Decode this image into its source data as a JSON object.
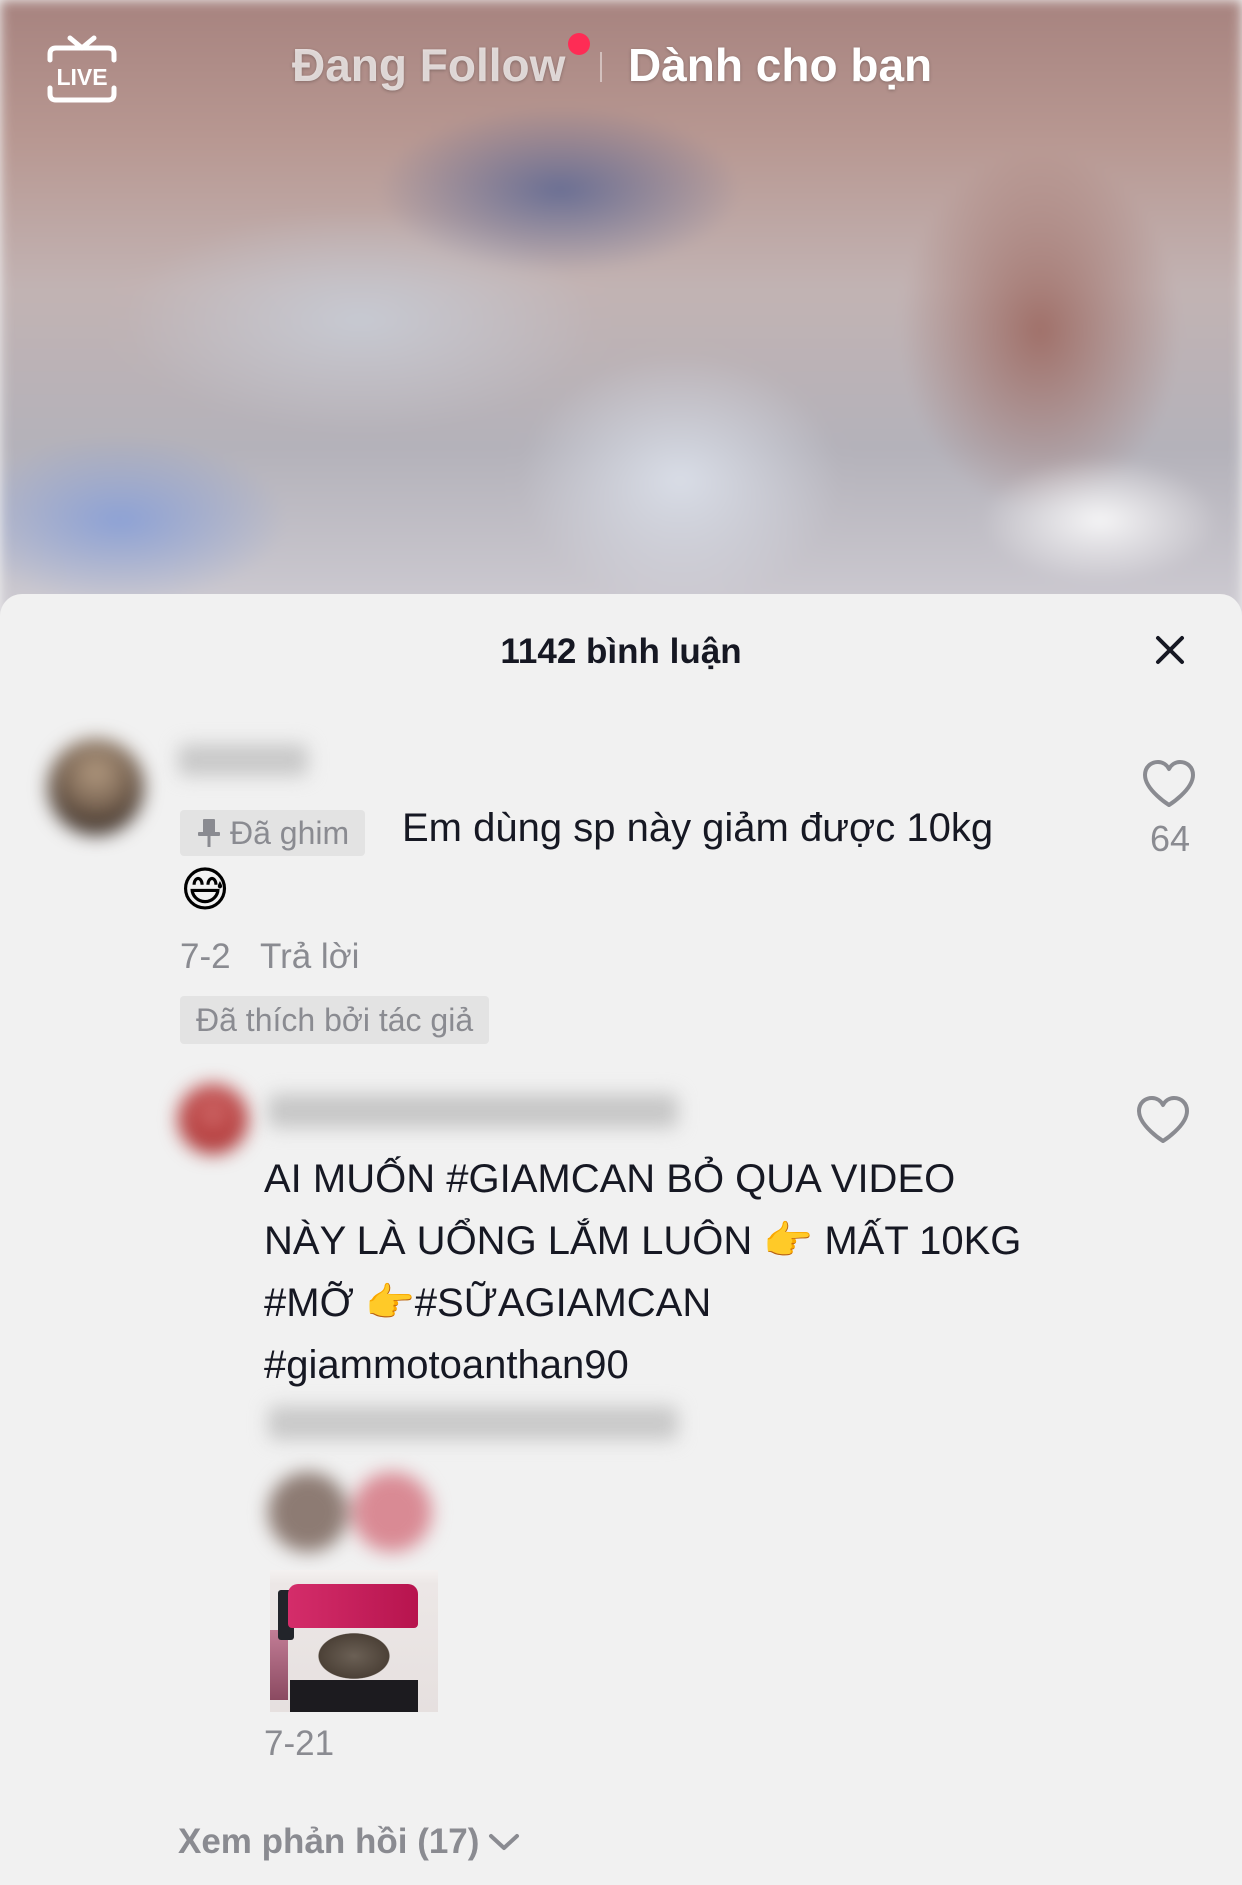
{
  "top_nav": {
    "live_label": "LIVE",
    "following_tab": "Đang Follow",
    "for_you_tab": "Dành cho bạn"
  },
  "comments_sheet": {
    "title": "1142 bình luận",
    "comments": [
      {
        "pinned_label": "Đã ghim",
        "text": "Em dùng sp này giảm được 10kg",
        "emoji": "😅",
        "date": "7-2",
        "reply_label": "Trả lời",
        "liked_by_author_label": "Đã thích bởi tác giả",
        "like_count": "64"
      },
      {
        "text_lines": [
          "AI MUỐN #GIAMCAN BỎ QUA VIDEO",
          "NÀY LÀ UỔNG LẮM LUÔN 👉 MẤT 10KG",
          "#MỠ  👉#SỮAGIAMCAN",
          "#giammotoanthan90"
        ],
        "date": "7-21",
        "view_replies_label": "Xem phản hồi (17)"
      }
    ]
  },
  "colors": {
    "accent": "#fe2c55",
    "text_primary": "#161823",
    "text_secondary": "#8a8b91",
    "sheet_background": "#f1f1f1",
    "badge_background": "#e3e3e3"
  },
  "icons": [
    "live-icon",
    "close-icon",
    "heart-outline-icon",
    "pin-icon",
    "chevron-down-icon"
  ]
}
